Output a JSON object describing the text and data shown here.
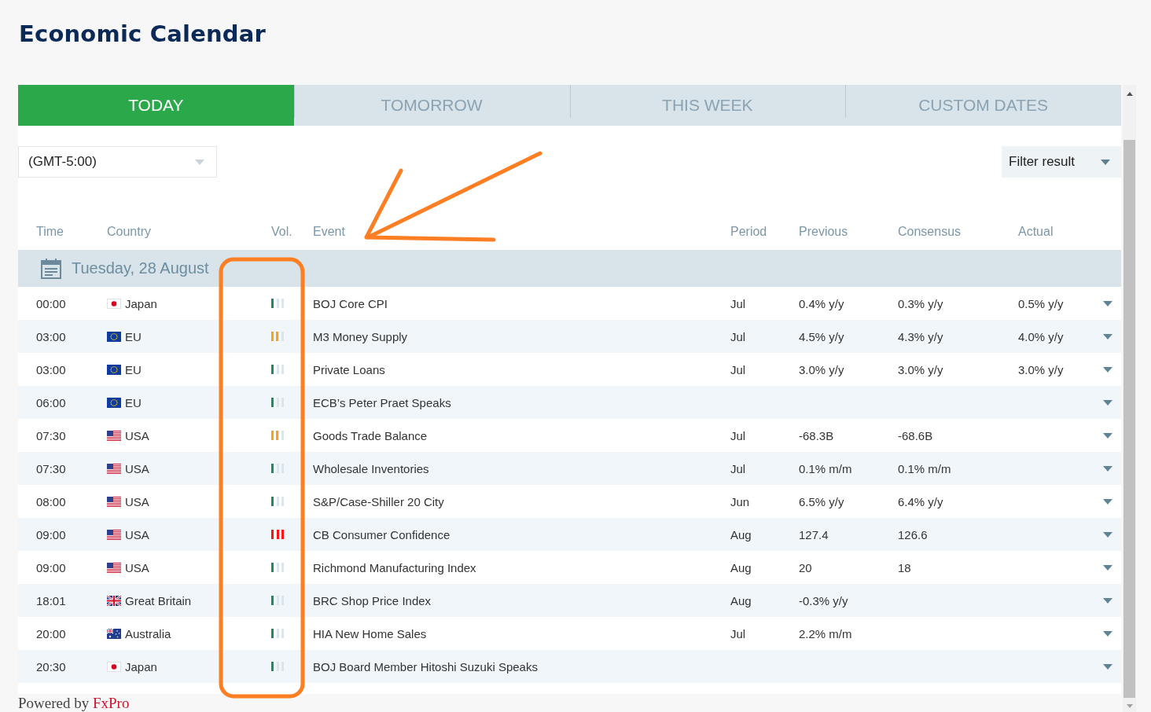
{
  "page": {
    "title": "Economic Calendar"
  },
  "tabs": [
    {
      "label": "TODAY",
      "selected": true
    },
    {
      "label": "TOMORROW",
      "selected": false
    },
    {
      "label": "THIS WEEK",
      "selected": false
    },
    {
      "label": "CUSTOM DATES",
      "selected": false
    }
  ],
  "timezone_select": {
    "value": "(GMT-5:00)"
  },
  "filter_button": {
    "label": "Filter result"
  },
  "table": {
    "columns": [
      "Time",
      "Country",
      "Vol.",
      "Event",
      "Period",
      "Previous",
      "Consensus",
      "Actual"
    ],
    "date_group": "Tuesday, 28 August",
    "rows": [
      {
        "time": "00:00",
        "flag": {
          "kind": "jp"
        },
        "country": "Japan",
        "level": 0.33,
        "event": "BOJ Core CPI",
        "period": "Jul",
        "previous": "0.4% y/y",
        "consensus": "0.3% y/y",
        "actual": "0.5% y/y"
      },
      {
        "time": "03:00",
        "flag": {
          "kind": "eu"
        },
        "country": "EU",
        "level": 0.67,
        "event": "M3 Money Supply",
        "period": "Jul",
        "previous": "4.5% y/y",
        "consensus": "4.3% y/y",
        "actual": "4.0% y/y"
      },
      {
        "time": "03:00",
        "flag": {
          "kind": "eu"
        },
        "country": "EU",
        "level": 0.33,
        "event": "Private Loans",
        "period": "Jul",
        "previous": "3.0% y/y",
        "consensus": "3.0% y/y",
        "actual": "3.0% y/y"
      },
      {
        "time": "06:00",
        "flag": {
          "kind": "eu"
        },
        "country": "EU",
        "level": 0.33,
        "event": "ECB’s Peter Praet Speaks"
      },
      {
        "time": "07:30",
        "flag": {
          "kind": "us"
        },
        "country": "USA",
        "level": 0.67,
        "event": "Goods Trade Balance",
        "period": "Jul",
        "previous": "-68.3B",
        "consensus": "-68.6B"
      },
      {
        "time": "07:30",
        "flag": {
          "kind": "us"
        },
        "country": "USA",
        "level": 0.33,
        "event": "Wholesale Inventories",
        "period": "Jul",
        "previous": "0.1% m/m",
        "consensus": "0.1% m/m"
      },
      {
        "time": "08:00",
        "flag": {
          "kind": "us"
        },
        "country": "USA",
        "level": 0.33,
        "event": "S&P/Case-Shiller 20 City",
        "period": "Jun",
        "previous": "6.5% y/y",
        "consensus": "6.4% y/y"
      },
      {
        "time": "09:00",
        "flag": {
          "kind": "us"
        },
        "country": "USA",
        "level": 1,
        "event": "CB Consumer Confidence",
        "period": "Aug",
        "previous": "127.4",
        "consensus": "126.6"
      },
      {
        "time": "09:00",
        "flag": {
          "kind": "us"
        },
        "country": "USA",
        "level": 0.33,
        "event": "Richmond Manufacturing Index",
        "period": "Aug",
        "previous": "20",
        "consensus": "18"
      },
      {
        "time": "18:01",
        "flag": {
          "kind": "gb"
        },
        "country": "Great Britain",
        "level": 0.33,
        "event": "BRC Shop Price Index",
        "period": "Aug",
        "previous": "-0.3% y/y"
      },
      {
        "time": "20:00",
        "flag": {
          "kind": "au"
        },
        "country": "Australia",
        "level": 0.33,
        "event": "HIA New Home Sales",
        "period": "Jul",
        "previous": "2.2% m/m"
      },
      {
        "time": "20:30",
        "flag": {
          "kind": "jp"
        },
        "country": "Japan",
        "level": 0.33,
        "event": "BOJ Board Member Hitoshi Suzuki Speaks"
      }
    ]
  },
  "footer": {
    "prefix": "Powered by",
    "brand": "FxPro"
  },
  "annotations": {
    "arrow": true,
    "highlight_box": true
  }
}
